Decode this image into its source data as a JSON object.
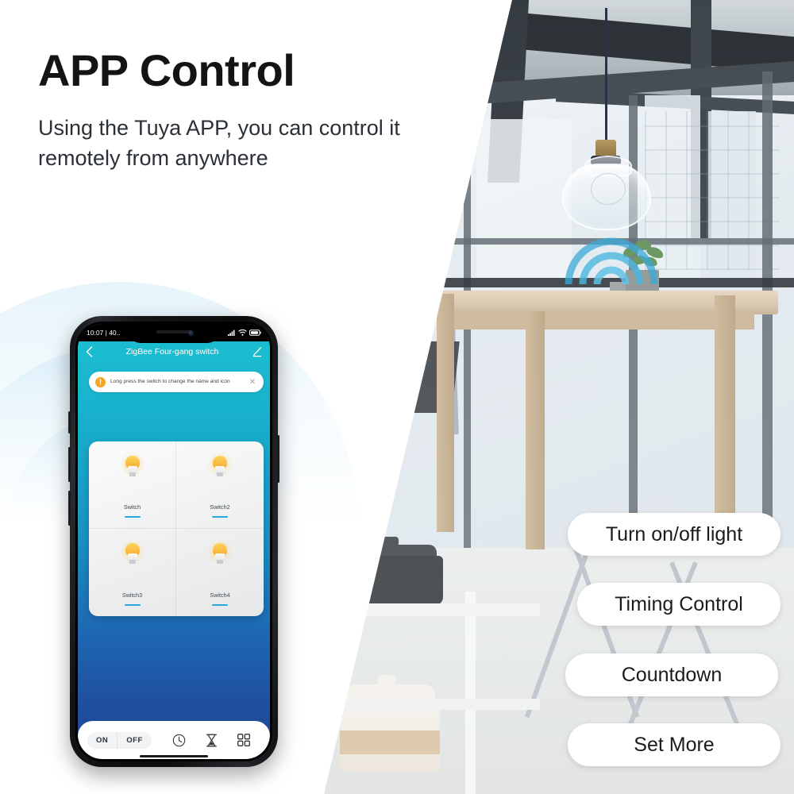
{
  "headline": "APP Control",
  "subtitle": "Using the Tuya APP, you can control it remotely from anywhere",
  "colors": {
    "accent_teal": "#1BBBD0",
    "app_gradient_top": "#1DBCCF",
    "app_gradient_bottom": "#1D4896",
    "bulb_yellow": "#F5AB2C",
    "indicator_blue": "#29A8E0",
    "wifi_arc_blue": "#BFE3F2",
    "headline_color": "#141414"
  },
  "phone": {
    "status_bar": {
      "time_text": "10:07 | 40..",
      "icons": [
        "signal-icon",
        "wifi-icon",
        "battery-icon"
      ]
    },
    "app_header": {
      "back_icon": "chevron-left-icon",
      "title": "ZigBee Four-gang switch",
      "edit_icon": "pencil-icon"
    },
    "banner": {
      "alert_icon": "exclamation-icon",
      "text": "Long press the switch to change the name and icon",
      "close_icon": "close-icon"
    },
    "switches": [
      {
        "label": "Switch",
        "icon": "bulb-icon",
        "state": "on"
      },
      {
        "label": "Switch2",
        "icon": "bulb-icon",
        "state": "on"
      },
      {
        "label": "Switch3",
        "icon": "bulb-icon",
        "state": "on"
      },
      {
        "label": "Switch4",
        "icon": "bulb-icon",
        "state": "on"
      }
    ],
    "bottom_bar": {
      "on_label": "ON",
      "off_label": "OFF",
      "timer_icon": "clock-icon",
      "countdown_icon": "hourglass-icon",
      "more_icon": "grid-icon"
    }
  },
  "features": [
    {
      "label": "Turn on/off light"
    },
    {
      "label": "Timing Control"
    },
    {
      "label": "Countdown"
    },
    {
      "label": "Set More"
    }
  ],
  "photo": {
    "scene_description": "Modern cafe interior with pendant lamp, wooden bar table, chair, potted plant and city windows",
    "pendant_lamp_icon": "pendant-lamp-icon",
    "signal_waves_icon": "signal-waves-icon"
  }
}
